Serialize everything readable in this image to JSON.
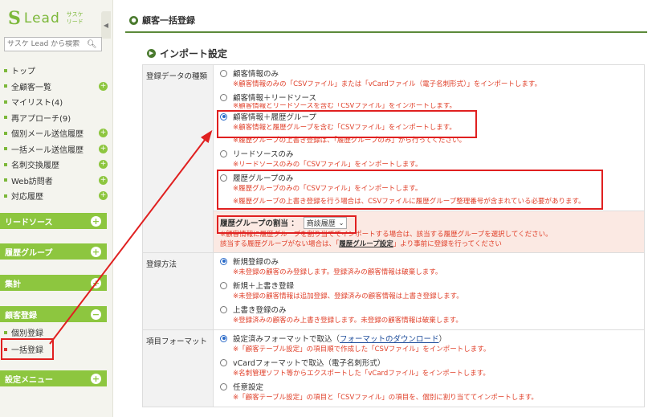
{
  "logo": {
    "mark": "S",
    "name": "Lead",
    "sub_line1": "サスケ",
    "sub_line2": "リード"
  },
  "search": {
    "placeholder": "サスケ Lead から検索"
  },
  "nav": [
    {
      "label": "トップ",
      "plus": false
    },
    {
      "label": "全顧客一覧",
      "plus": true
    },
    {
      "label": "マイリスト(4)",
      "plus": false
    },
    {
      "label": "再アプローチ(9)",
      "plus": false
    },
    {
      "label": "個別メール送信履歴",
      "plus": true
    },
    {
      "label": "一括メール送信履歴",
      "plus": true
    },
    {
      "label": "名刺交換履歴",
      "plus": true
    },
    {
      "label": "Web訪問者",
      "plus": true
    },
    {
      "label": "対応履歴",
      "plus": true
    }
  ],
  "sections": {
    "lead_source": "リードソース",
    "history_group": "履歴グループ",
    "aggregate": "集計",
    "customer_register": "顧客登録",
    "settings_menu": "設定メニュー"
  },
  "customer_register_items": [
    "個別登録",
    "一括登録"
  ],
  "page": {
    "title": "顧客一括登録",
    "section_title": "インポート設定"
  },
  "form": {
    "data_type": {
      "label": "登録データの種類",
      "options": [
        {
          "label": "顧客情報のみ",
          "note": "※顧客情報のみの「CSVファイル」または「vCardファイル（電子名刺形式）」をインポートします。"
        },
        {
          "label": "顧客情報＋リードソース",
          "note": "※顧客情報とリードソースを含む「CSVファイル」をインポートします。"
        },
        {
          "label": "顧客情報＋履歴グループ",
          "note": "※顧客情報と履歴グループを含む「CSVファイル」をインポートします。",
          "note2": "※履歴グループの上書き登録は、「履歴グループのみ」から行ってください。"
        },
        {
          "label": "リードソースのみ",
          "note": "※リードソースのみの「CSVファイル」をインポートします。"
        },
        {
          "label": "履歴グループのみ",
          "note": "※履歴グループのみの「CSVファイル」をインポートします。",
          "note2": "※履歴グループの上書き登録を行う場合は、CSVファイルに履歴グループ整理番号が含まれている必要があります。"
        }
      ],
      "selected": 2
    },
    "assign": {
      "label": "履歴グループの割当 ：",
      "select_value": "商談履歴",
      "note1": "※顧客情報に履歴グループを割り当ててインポートする場合は、該当する履歴グループを選択してください。",
      "note2_prefix": "該当する履歴グループがない場合は、「",
      "note2_link": "履歴グループ設定",
      "note2_suffix": "」より事前に登録を行ってください"
    },
    "method": {
      "label": "登録方法",
      "options": [
        {
          "label": "新規登録のみ",
          "note": "※未登録の顧客のみ登録します。登録済みの顧客情報は破棄します。"
        },
        {
          "label": "新規＋上書き登録",
          "note": "※未登録の顧客情報は追加登録、登録済みの顧客情報は上書き登録します。"
        },
        {
          "label": "上書き登録のみ",
          "note": "※登録済みの顧客のみ上書き登録します。未登録の顧客情報は破棄します。"
        }
      ],
      "selected": 0
    },
    "format": {
      "label": "項目フォーマット",
      "options": [
        {
          "label": "設定済みフォーマットで取込（",
          "link": "フォーマットのダウンロード",
          "suffix": "）",
          "note": "※「顧客テーブル設定」の項目順で作成した「CSVファイル」をインポートします。"
        },
        {
          "label": "vCardフォーマットで取込（電子名刺形式）",
          "note": "※名刺管理ソフト等からエクスポートした「vCardファイル」をインポートします。"
        },
        {
          "label": "任意設定",
          "note": "※「顧客テーブル設定」の項目と「CSVファイル」の項目を、個別に割り当ててインポートします。"
        }
      ],
      "selected": 0
    }
  },
  "colors": {
    "accent_green": "#8dc63f",
    "header_green": "#5c8a3a",
    "note_red": "#e0402a",
    "highlight_red": "#e02020",
    "assign_bg": "#fbe9e3"
  }
}
